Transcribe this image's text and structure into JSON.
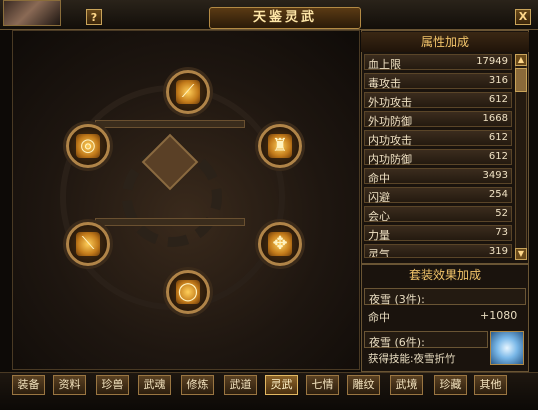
{
  "window": {
    "title": "天鉴灵武",
    "help_label": "?",
    "close_label": "X"
  },
  "attributes": {
    "header": "属性加成",
    "rows": [
      {
        "name": "血上限",
        "value": "17949"
      },
      {
        "name": "毒攻击",
        "value": "316"
      },
      {
        "name": "外功攻击",
        "value": "612"
      },
      {
        "name": "外功防御",
        "value": "1668"
      },
      {
        "name": "内功攻击",
        "value": "612"
      },
      {
        "name": "内功防御",
        "value": "612"
      },
      {
        "name": "命中",
        "value": "3493"
      },
      {
        "name": "闪避",
        "value": "254"
      },
      {
        "name": "会心",
        "value": "52"
      },
      {
        "name": "力量",
        "value": "73"
      },
      {
        "name": "灵气",
        "value": "319"
      }
    ]
  },
  "set_bonus": {
    "header": "套装效果加成",
    "set3_label": "夜雪 (3件):",
    "set3_stat_name": "命中",
    "set3_stat_value": "+1080",
    "set6_label": "夜雪 (6件):",
    "set6_skill": "获得技能:夜雪折竹"
  },
  "equipment_slots": [
    {
      "name": "spear",
      "icon": "spear-icon"
    },
    {
      "name": "ring-left",
      "icon": "ring-icon"
    },
    {
      "name": "armor",
      "icon": "armor-icon"
    },
    {
      "name": "dagger",
      "icon": "dagger-icon"
    },
    {
      "name": "fan",
      "icon": "fan-icon"
    },
    {
      "name": "bracelet",
      "icon": "bracelet-icon"
    }
  ],
  "tabs": [
    {
      "label": "装备",
      "active": false
    },
    {
      "label": "资料",
      "active": false
    },
    {
      "label": "珍兽",
      "active": false
    },
    {
      "label": "武魂",
      "active": false
    },
    {
      "label": "修炼",
      "active": false
    },
    {
      "label": "武道",
      "active": false
    },
    {
      "label": "灵武",
      "active": true
    },
    {
      "label": "七情",
      "active": false
    },
    {
      "label": "雕纹",
      "active": false
    },
    {
      "label": "武境",
      "active": false
    },
    {
      "label": "珍藏",
      "active": false
    },
    {
      "label": "其他",
      "active": false
    }
  ],
  "colors": {
    "gold_text": "#f2c46a",
    "panel_bg": "#1a130d",
    "border": "#6a5534"
  }
}
